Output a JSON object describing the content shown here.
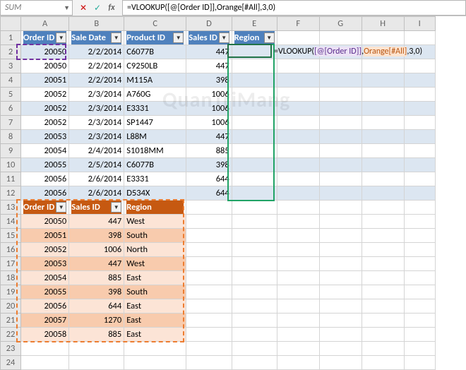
{
  "chart_data": {
    "type": "table",
    "tables": [
      {
        "name": "Blue",
        "columns": [
          "Order ID",
          "Sale Date",
          "Product ID",
          "Sales ID",
          "Region"
        ],
        "rows": [
          [
            20050,
            "2/2/2014",
            "C6077B",
            447,
            null
          ],
          [
            20050,
            "2/2/2014",
            "C9250LB",
            447,
            null
          ],
          [
            20051,
            "2/2/2014",
            "M115A",
            398,
            null
          ],
          [
            20052,
            "2/3/2014",
            "A760G",
            1006,
            null
          ],
          [
            20052,
            "2/3/2014",
            "E3331",
            1006,
            null
          ],
          [
            20052,
            "2/3/2014",
            "SP1447",
            1006,
            null
          ],
          [
            20053,
            "2/3/2014",
            "L88M",
            447,
            null
          ],
          [
            20054,
            "2/4/2014",
            "S1018MM",
            885,
            null
          ],
          [
            20055,
            "2/5/2014",
            "C6077B",
            398,
            null
          ],
          [
            20056,
            "2/6/2014",
            "E3331",
            644,
            null
          ],
          [
            20056,
            "2/6/2014",
            "D534X",
            644,
            null
          ]
        ]
      },
      {
        "name": "Orange",
        "columns": [
          "Order ID",
          "Sales ID",
          "Region"
        ],
        "rows": [
          [
            20050,
            447,
            "West"
          ],
          [
            20051,
            398,
            "South"
          ],
          [
            20052,
            1006,
            "North"
          ],
          [
            20053,
            447,
            "West"
          ],
          [
            20054,
            885,
            "East"
          ],
          [
            20055,
            398,
            "South"
          ],
          [
            20056,
            644,
            "East"
          ],
          [
            20057,
            1270,
            "East"
          ],
          [
            20058,
            885,
            "East"
          ]
        ]
      }
    ]
  },
  "fx": {
    "name_box": "SUM",
    "formula": "=VLOOKUP([@[Order ID]],Orange[#All],3,0)",
    "overflow_prefix": "=VLOOKUP(",
    "tok1": " [@[Order ID]] ",
    "sep1": " ,",
    "tok2": " Orange[#All] ",
    "suffix": " ,3,0)"
  },
  "cols": [
    "A",
    "B",
    "C",
    "D",
    "E",
    "F",
    "G",
    "H",
    "I"
  ],
  "t1h": {
    "c0": "Order ID",
    "c1": "Sale Date",
    "c2": "Product ID",
    "c3": "Sales ID",
    "c4": "Region"
  },
  "t1": [
    {
      "a": "20050",
      "b": "2/2/2014",
      "c": "C6077B",
      "d": "447"
    },
    {
      "a": "20050",
      "b": "2/2/2014",
      "c": "C9250LB",
      "d": "447"
    },
    {
      "a": "20051",
      "b": "2/2/2014",
      "c": "M115A",
      "d": "398"
    },
    {
      "a": "20052",
      "b": "2/3/2014",
      "c": "A760G",
      "d": "1006"
    },
    {
      "a": "20052",
      "b": "2/3/2014",
      "c": "E3331",
      "d": "1006"
    },
    {
      "a": "20052",
      "b": "2/3/2014",
      "c": "SP1447",
      "d": "1006"
    },
    {
      "a": "20053",
      "b": "2/3/2014",
      "c": "L88M",
      "d": "447"
    },
    {
      "a": "20054",
      "b": "2/4/2014",
      "c": "S1018MM",
      "d": "885"
    },
    {
      "a": "20055",
      "b": "2/5/2014",
      "c": "C6077B",
      "d": "398"
    },
    {
      "a": "20056",
      "b": "2/6/2014",
      "c": "E3331",
      "d": "644"
    },
    {
      "a": "20056",
      "b": "2/6/2014",
      "c": "D534X",
      "d": "644"
    }
  ],
  "t2h": {
    "c0": "Order ID",
    "c1": "Sales ID",
    "c2": "Region"
  },
  "t2": [
    {
      "a": "20050",
      "b": "447",
      "c": "West"
    },
    {
      "a": "20051",
      "b": "398",
      "c": "South"
    },
    {
      "a": "20052",
      "b": "1006",
      "c": "North"
    },
    {
      "a": "20053",
      "b": "447",
      "c": "West"
    },
    {
      "a": "20054",
      "b": "885",
      "c": "East"
    },
    {
      "a": "20055",
      "b": "398",
      "c": "South"
    },
    {
      "a": "20056",
      "b": "644",
      "c": "East"
    },
    {
      "a": "20057",
      "b": "1270",
      "c": "East"
    },
    {
      "a": "20058",
      "b": "885",
      "c": "East"
    }
  ],
  "rows_extra": [
    "23",
    "24"
  ],
  "watermark": "QuanTriMang"
}
